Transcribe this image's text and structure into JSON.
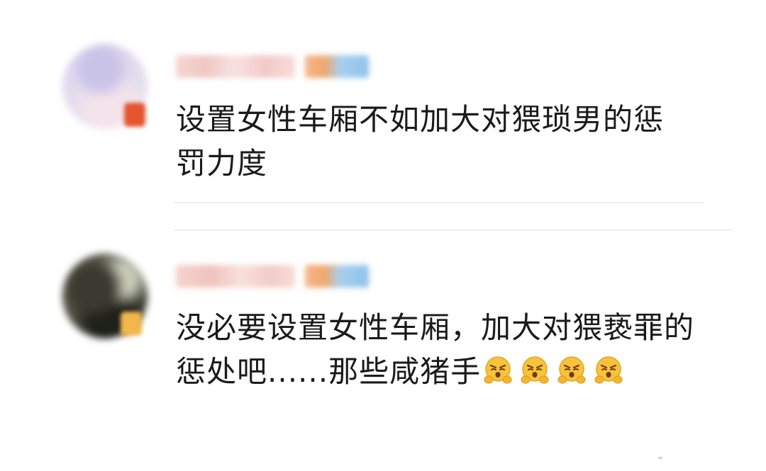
{
  "comments": [
    {
      "text": "设置女性车厢不如加大对猥琐男的惩罚力度",
      "emojis": []
    },
    {
      "text": "没必要设置女性车厢，加大对猥亵罪的惩处吧......那些咸猪手",
      "emojis": [
        "angry-face-icon",
        "angry-face-icon",
        "angry-face-icon",
        "angry-face-icon"
      ]
    }
  ],
  "colors": {
    "text": "#1a1a1a",
    "divider": "#eeeeee",
    "emoji_face": "#f7c23c"
  }
}
